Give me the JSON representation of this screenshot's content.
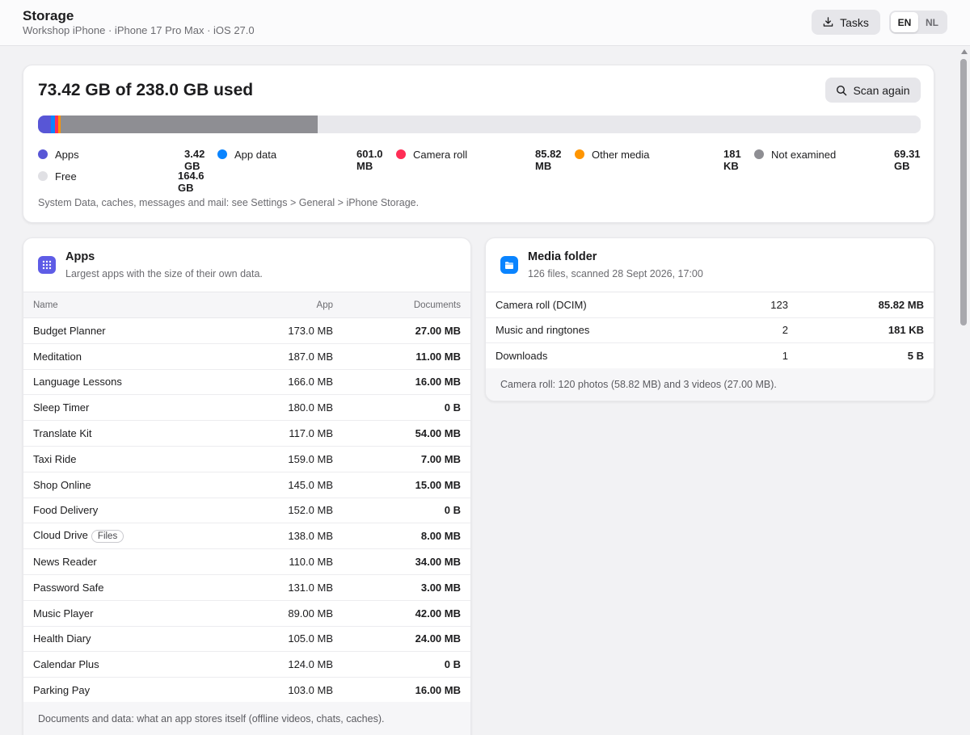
{
  "header": {
    "title": "Storage",
    "subtitle": "Workshop iPhone · iPhone 17 Pro Max · iOS 27.0",
    "tasks_label": "Tasks",
    "languages": [
      "EN",
      "NL"
    ],
    "active_language": "EN"
  },
  "summary": {
    "heading": "73.42 GB of 238.0 GB used",
    "scan_label": "Scan again",
    "usage_bar": [
      {
        "name": "Apps",
        "fraction": 0.0144,
        "color": "#5856d6"
      },
      {
        "name": "App data",
        "fraction": 0.0047,
        "color": "#0a84ff"
      },
      {
        "name": "Camera roll",
        "fraction": 0.004,
        "color": "#ff2d55"
      },
      {
        "name": "Other media",
        "fraction": 0.003,
        "color": "#ff9500"
      },
      {
        "name": "Not examined",
        "fraction": 0.2912,
        "color": "#8e8e93"
      }
    ],
    "legend": [
      {
        "label": "Apps",
        "value": "3.42 GB",
        "color": "#5856d6"
      },
      {
        "label": "App data",
        "value": "601.0 MB",
        "color": "#0a84ff"
      },
      {
        "label": "Camera roll",
        "value": "85.82 MB",
        "color": "#ff2d55"
      },
      {
        "label": "Other media",
        "value": "181 KB",
        "color": "#ff9500"
      },
      {
        "label": "Not examined",
        "value": "69.31 GB",
        "color": "#8e8e93"
      },
      {
        "label": "Free",
        "value": "164.6 GB",
        "color": "#e0e0e4"
      }
    ],
    "note": "System Data, caches, messages and mail: see Settings > General > iPhone Storage."
  },
  "apps": {
    "icon": "apps-grid-icon",
    "title": "Apps",
    "subtitle": "Largest apps with the size of their own data.",
    "columns": [
      "Name",
      "App",
      "Documents"
    ],
    "rows": [
      {
        "name": "Budget Planner",
        "app": "173.0 MB",
        "docs": "27.00 MB"
      },
      {
        "name": "Meditation",
        "app": "187.0 MB",
        "docs": "11.00 MB"
      },
      {
        "name": "Language Lessons",
        "app": "166.0 MB",
        "docs": "16.00 MB"
      },
      {
        "name": "Sleep Timer",
        "app": "180.0 MB",
        "docs": "0 B"
      },
      {
        "name": "Translate Kit",
        "app": "117.0 MB",
        "docs": "54.00 MB"
      },
      {
        "name": "Taxi Ride",
        "app": "159.0 MB",
        "docs": "7.00 MB"
      },
      {
        "name": "Shop Online",
        "app": "145.0 MB",
        "docs": "15.00 MB"
      },
      {
        "name": "Food Delivery",
        "app": "152.0 MB",
        "docs": "0 B"
      },
      {
        "name": "Cloud Drive",
        "badge": "Files",
        "app": "138.0 MB",
        "docs": "8.00 MB"
      },
      {
        "name": "News Reader",
        "app": "110.0 MB",
        "docs": "34.00 MB"
      },
      {
        "name": "Password Safe",
        "app": "131.0 MB",
        "docs": "3.00 MB"
      },
      {
        "name": "Music Player",
        "app": "89.00 MB",
        "docs": "42.00 MB"
      },
      {
        "name": "Health Diary",
        "app": "105.0 MB",
        "docs": "24.00 MB"
      },
      {
        "name": "Calendar Plus",
        "app": "124.0 MB",
        "docs": "0 B"
      },
      {
        "name": "Parking Pay",
        "app": "103.0 MB",
        "docs": "16.00 MB"
      }
    ],
    "footer": "Documents and data: what an app stores itself (offline videos, chats, caches)."
  },
  "media": {
    "icon": "folder-icon",
    "title": "Media folder",
    "subtitle": "126 files, scanned 28 Sept 2026, 17:00",
    "rows": [
      {
        "name": "Camera roll (DCIM)",
        "count": "123",
        "size": "85.82 MB"
      },
      {
        "name": "Music and ringtones",
        "count": "2",
        "size": "181 KB"
      },
      {
        "name": "Downloads",
        "count": "1",
        "size": "5 B"
      }
    ],
    "footer": "Camera roll: 120 photos (58.82 MB) and 3 videos (27.00 MB)."
  }
}
